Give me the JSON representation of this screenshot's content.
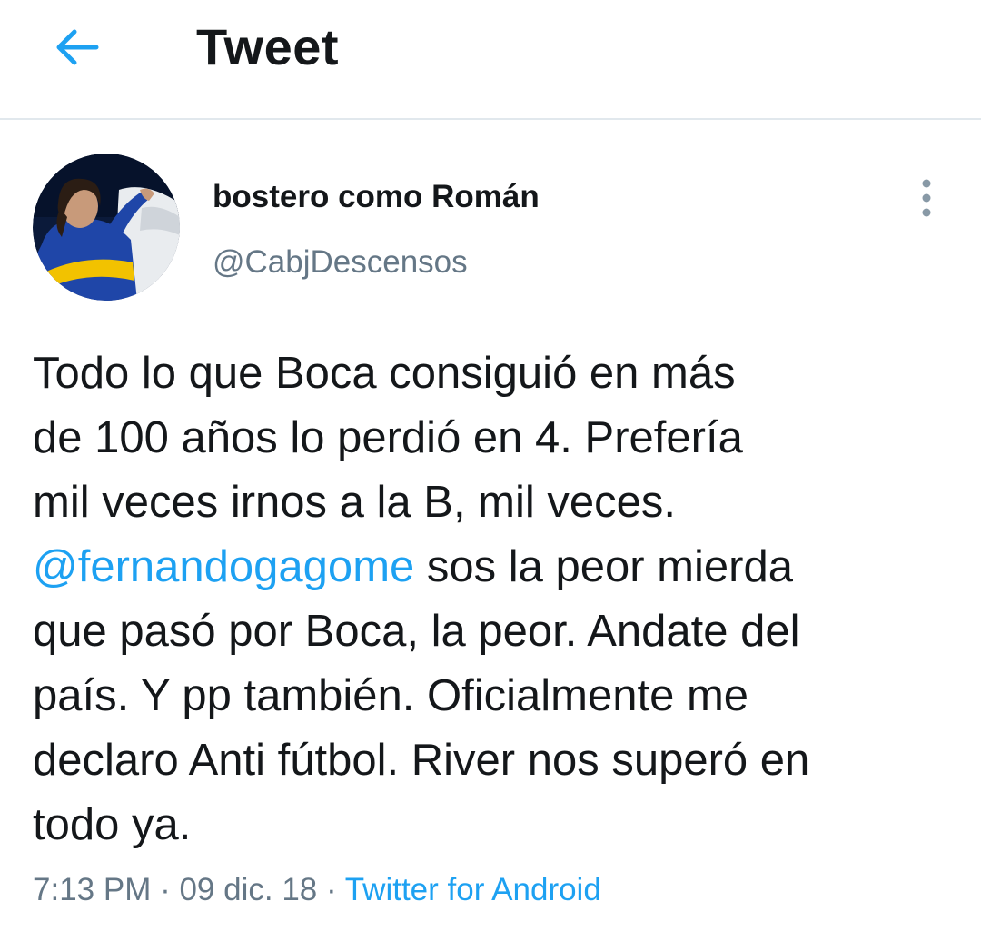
{
  "header": {
    "title": "Tweet",
    "back_icon": "arrow-left-icon"
  },
  "author": {
    "display_name": "bostero como Román",
    "handle": "@CabjDescensos"
  },
  "tweet": {
    "lines": [
      {
        "text": "Todo lo que Boca consiguió en más"
      },
      {
        "text": "de 100 años lo perdió en 4. Prefería"
      },
      {
        "text": "mil veces irnos a la B, mil veces."
      },
      {
        "mention": "@fernandogagome",
        "text": " sos la peor mierda"
      },
      {
        "text": "que pasó por Boca, la peor. Andate del"
      },
      {
        "text": "país. Y pp también. Oficialmente me"
      },
      {
        "text": "declaro Anti fútbol. River nos superó en"
      },
      {
        "text": "todo ya."
      }
    ],
    "time": "7:13 PM",
    "separator": " · ",
    "date": "09 dic. 18",
    "source": "Twitter for Android"
  },
  "colors": {
    "accent": "#1da1f2",
    "text": "#14171a",
    "secondary": "#657786",
    "divider": "#e1e8ed"
  }
}
